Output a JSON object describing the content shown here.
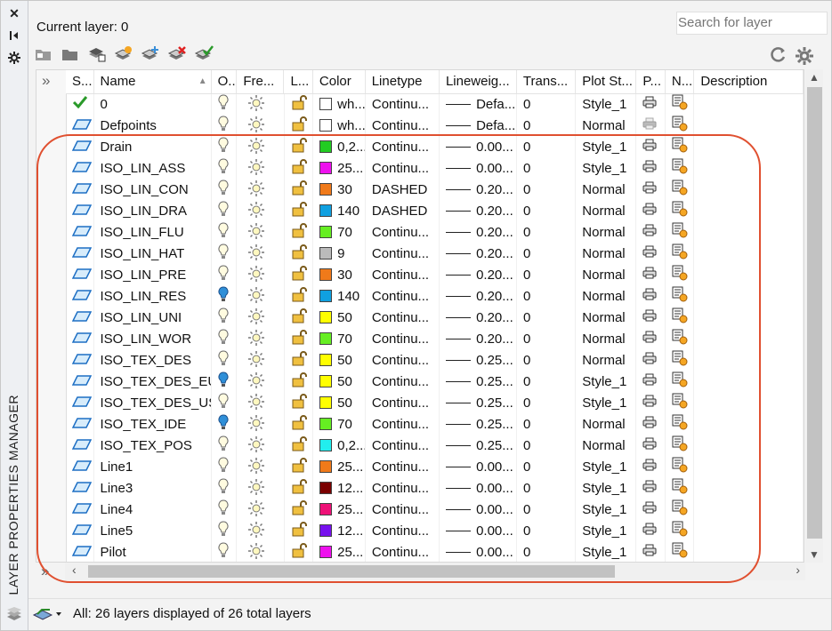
{
  "current_layer_label": "Current layer: 0",
  "search_placeholder": "Search for layer",
  "palette_title": "LAYER PROPERTIES MANAGER",
  "status_text": "All: 26 layers displayed of 26 total layers",
  "columns": [
    "S...",
    "Name",
    "O...",
    "Fre...",
    "L...",
    "Color",
    "Linetype",
    "Lineweig...",
    "Trans...",
    "Plot St...",
    "P...",
    "N...",
    "Description"
  ],
  "rows": [
    {
      "status": "current",
      "name": "0",
      "color_hex": "#ffffff",
      "color": "wh...",
      "linetype": "Continu...",
      "lineweight": "Defa...",
      "trans": "0",
      "plot_style": "Style_1",
      "on": true,
      "plot": true
    },
    {
      "status": "layer",
      "name": "Defpoints",
      "color_hex": "#ffffff",
      "color": "wh...",
      "linetype": "Continu...",
      "lineweight": "Defa...",
      "trans": "0",
      "plot_style": "Normal",
      "on": true,
      "plot": false
    },
    {
      "status": "layer",
      "name": "Drain",
      "color_hex": "#22cc22",
      "color": "0,2...",
      "linetype": "Continu...",
      "lineweight": "0.00...",
      "trans": "0",
      "plot_style": "Style_1",
      "on": true,
      "plot": true
    },
    {
      "status": "layer",
      "name": "ISO_LIN_ASS",
      "color_hex": "#ee11ee",
      "color": "25...",
      "linetype": "Continu...",
      "lineweight": "0.00...",
      "trans": "0",
      "plot_style": "Style_1",
      "on": true,
      "plot": true
    },
    {
      "status": "layer",
      "name": "ISO_LIN_CON",
      "color_hex": "#f07a1a",
      "color": "30",
      "linetype": "DASHED",
      "lineweight": "0.20...",
      "trans": "0",
      "plot_style": "Normal",
      "on": true,
      "plot": true
    },
    {
      "status": "layer",
      "name": "ISO_LIN_DRA",
      "color_hex": "#10a0e0",
      "color": "140",
      "linetype": "DASHED",
      "lineweight": "0.20...",
      "trans": "0",
      "plot_style": "Normal",
      "on": true,
      "plot": true
    },
    {
      "status": "layer",
      "name": "ISO_LIN_FLU",
      "color_hex": "#66ee22",
      "color": "70",
      "linetype": "Continu...",
      "lineweight": "0.20...",
      "trans": "0",
      "plot_style": "Normal",
      "on": true,
      "plot": true
    },
    {
      "status": "layer",
      "name": "ISO_LIN_HAT",
      "color_hex": "#bbbbbb",
      "color": "9",
      "linetype": "Continu...",
      "lineweight": "0.20...",
      "trans": "0",
      "plot_style": "Normal",
      "on": true,
      "plot": true
    },
    {
      "status": "layer",
      "name": "ISO_LIN_PRE",
      "color_hex": "#f07a1a",
      "color": "30",
      "linetype": "Continu...",
      "lineweight": "0.20...",
      "trans": "0",
      "plot_style": "Normal",
      "on": true,
      "plot": true
    },
    {
      "status": "layer",
      "name": "ISO_LIN_RES",
      "color_hex": "#10a0e0",
      "color": "140",
      "linetype": "Continu...",
      "lineweight": "0.20...",
      "trans": "0",
      "plot_style": "Normal",
      "on": false,
      "plot": true
    },
    {
      "status": "layer",
      "name": "ISO_LIN_UNI",
      "color_hex": "#ffff00",
      "color": "50",
      "linetype": "Continu...",
      "lineweight": "0.20...",
      "trans": "0",
      "plot_style": "Normal",
      "on": true,
      "plot": true
    },
    {
      "status": "layer",
      "name": "ISO_LIN_WOR",
      "color_hex": "#66ee22",
      "color": "70",
      "linetype": "Continu...",
      "lineweight": "0.20...",
      "trans": "0",
      "plot_style": "Normal",
      "on": true,
      "plot": true
    },
    {
      "status": "layer",
      "name": "ISO_TEX_DES",
      "color_hex": "#ffff00",
      "color": "50",
      "linetype": "Continu...",
      "lineweight": "0.25...",
      "trans": "0",
      "plot_style": "Normal",
      "on": true,
      "plot": true
    },
    {
      "status": "layer",
      "name": "ISO_TEX_DES_EU",
      "color_hex": "#ffff00",
      "color": "50",
      "linetype": "Continu...",
      "lineweight": "0.25...",
      "trans": "0",
      "plot_style": "Style_1",
      "on": false,
      "plot": true
    },
    {
      "status": "layer",
      "name": "ISO_TEX_DES_US",
      "color_hex": "#ffff00",
      "color": "50",
      "linetype": "Continu...",
      "lineweight": "0.25...",
      "trans": "0",
      "plot_style": "Style_1",
      "on": true,
      "plot": true
    },
    {
      "status": "layer",
      "name": "ISO_TEX_IDE",
      "color_hex": "#66ee22",
      "color": "70",
      "linetype": "Continu...",
      "lineweight": "0.25...",
      "trans": "0",
      "plot_style": "Normal",
      "on": false,
      "plot": true
    },
    {
      "status": "layer",
      "name": "ISO_TEX_POS",
      "color_hex": "#22eeee",
      "color": "0,2...",
      "linetype": "Continu...",
      "lineweight": "0.25...",
      "trans": "0",
      "plot_style": "Normal",
      "on": true,
      "plot": true
    },
    {
      "status": "layer",
      "name": "Line1",
      "color_hex": "#f07a1a",
      "color": "25...",
      "linetype": "Continu...",
      "lineweight": "0.00...",
      "trans": "0",
      "plot_style": "Style_1",
      "on": true,
      "plot": true
    },
    {
      "status": "layer",
      "name": "Line3",
      "color_hex": "#7a0000",
      "color": "12...",
      "linetype": "Continu...",
      "lineweight": "0.00...",
      "trans": "0",
      "plot_style": "Style_1",
      "on": true,
      "plot": true
    },
    {
      "status": "layer",
      "name": "Line4",
      "color_hex": "#ee1177",
      "color": "25...",
      "linetype": "Continu...",
      "lineweight": "0.00...",
      "trans": "0",
      "plot_style": "Style_1",
      "on": true,
      "plot": true
    },
    {
      "status": "layer",
      "name": "Line5",
      "color_hex": "#7711ee",
      "color": "12...",
      "linetype": "Continu...",
      "lineweight": "0.00...",
      "trans": "0",
      "plot_style": "Style_1",
      "on": true,
      "plot": true
    },
    {
      "status": "layer",
      "name": "Pilot",
      "color_hex": "#ee11ee",
      "color": "25...",
      "linetype": "Continu...",
      "lineweight": "0.00...",
      "trans": "0",
      "plot_style": "Style_1",
      "on": true,
      "plot": true
    }
  ]
}
